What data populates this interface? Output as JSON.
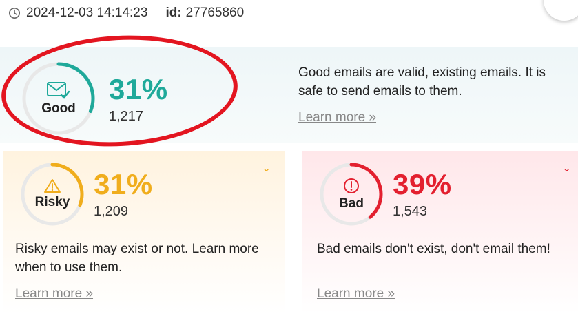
{
  "header": {
    "timestamp": "2024-12-03 14:14:23",
    "id_label": "id:",
    "id_value": "27765860"
  },
  "cards": {
    "good": {
      "label": "Good",
      "percent": "31%",
      "count": "1,217",
      "fraction": 0.31,
      "description": "Good emails are valid, existing emails. It is safe to send emails to them.",
      "learn_more": "Learn more »",
      "color": "#1fa99a",
      "icon": "envelope-check-icon"
    },
    "risky": {
      "label": "Risky",
      "percent": "31%",
      "count": "1,209",
      "fraction": 0.31,
      "description": "Risky emails may exist or not. Learn more when to use them.",
      "learn_more": "Learn more »",
      "color": "#f0ad1c",
      "icon": "warning-icon"
    },
    "bad": {
      "label": "Bad",
      "percent": "39%",
      "count": "1,543",
      "fraction": 0.39,
      "description": "Bad emails don't exist, don't email them!",
      "learn_more": "Learn more »",
      "color": "#e3202f",
      "icon": "error-circle-icon"
    }
  }
}
